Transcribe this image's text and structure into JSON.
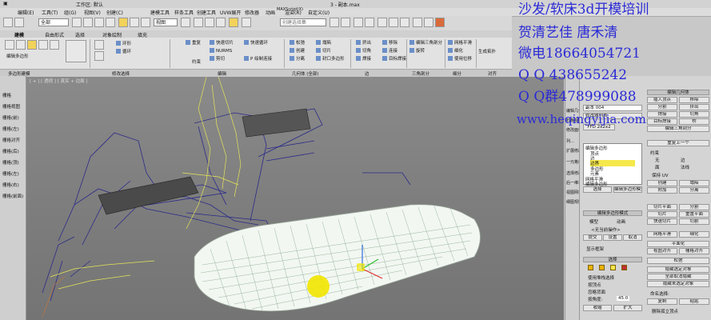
{
  "window": {
    "workspace_label": "工作区: 默认",
    "file_title": "3 - 副本.max",
    "colors": {
      "overlay_text": "#2b2bd6",
      "selection_highlight": "#f5e84a",
      "viewport_bg": "#808080",
      "mesh_wire": "#f2f7f2",
      "gizmo_yellow": "#f2e600"
    }
  },
  "menubar": {
    "items": [
      "编辑(E)",
      "工具(T)",
      "组(G)",
      "视图(V)",
      "创建(C)",
      "修改器",
      "动画",
      "图形编辑器",
      "渲染(R)",
      "Civil View",
      "自定义(U)",
      "脚本(S)",
      "MAXScript(X)",
      "帮助(H)"
    ],
    "contextual_tabs": [
      "建模工具",
      "样条工具",
      "创建工具",
      "UVW展开",
      "渲染(R)",
      "MAXScript(X)"
    ]
  },
  "toolbar": {
    "undo_combo": "全部",
    "view_combo": "视图",
    "selection_set_placeholder": "创建选择集"
  },
  "ribbon": {
    "tabs": [
      "建模",
      "自由形式",
      "选择",
      "对象绘制",
      "填充"
    ],
    "groups": {
      "polygon_modeling": "多边形建模",
      "modify_selection": "修改选择",
      "edit": "编辑",
      "geometry_all": "几何体 (全部)",
      "edges": "边",
      "loops": "循环",
      "tris": "三角剖分",
      "subdivision": "细分",
      "align": "对齐"
    },
    "edit_buttons": [
      "重复",
      "快速切片",
      "快速循环",
      "NURMS",
      "剪切",
      "约束",
      "P 绘制连接"
    ],
    "geometry_buttons": [
      "松弛",
      "创建",
      "分离",
      "塌陷",
      "切片",
      "封口多边形"
    ],
    "edge_buttons": [
      "挤出",
      "切角",
      "焊接",
      "移除",
      "连接",
      "目标焊接"
    ],
    "loop_buttons": [
      "编辑三角剖分",
      "旋转"
    ],
    "subdiv_buttons": [
      "网格平滑",
      "细化",
      "使用位移"
    ],
    "preview": "生成拓扑"
  },
  "viewport": {
    "label": "[ + ] [ 透视 ] [ 真实 + 边面 ]"
  },
  "left_panel": {
    "items": [
      "栅格",
      "栅格视图",
      "栅格(前)",
      "栅格(左)",
      "栅格对齐",
      "栅格(后)",
      "栅格(顶)",
      "栅格(左)",
      "栅格(右)",
      "栅格(前面)",
      "栅格(底部)",
      "栅格(底部)"
    ]
  },
  "mid_panel": {
    "items": [
      "编辑几何",
      "石板视图",
      "修改面板",
      "列…",
      "扩展修改",
      "一元格板",
      "选择修改",
      "后一维视",
      "视图网格",
      "细图规则"
    ]
  },
  "command_panel": {
    "object_name": "副本 004",
    "modifier_list": "修改器列表",
    "ffd_button": "FFD 2x2x2",
    "stack_items": [
      "编辑多边形",
      "顶点",
      "边",
      "边界",
      "多边形",
      "元素",
      "网格平滑",
      "编辑多边形"
    ],
    "stack_buttons": [
      "选择",
      "编辑多边形模式"
    ],
    "edit_poly_mode": {
      "header": "编辑多边形模式",
      "mode_model": "模型",
      "mode_anim": "动画",
      "no_op": "<无当前操作>",
      "commit": "提交",
      "settings": "设置",
      "cancel": "取消",
      "show_cage": "显示框架"
    },
    "selection": {
      "header": "选择",
      "use_stack": "使用堆栈选择",
      "by_vertex": "按顶点",
      "ignore_back": "忽略背面",
      "angle_label": "按角度:",
      "angle_value": "45.0",
      "shrink": "收缩",
      "grow": "扩大",
      "ring": "环形",
      "loop": "循环"
    },
    "edit_geometry": {
      "header": "编辑几何体",
      "repeat_last": "重复上一个",
      "constraints": "约束",
      "none": "无",
      "edge": "边",
      "face": "面",
      "normal": "法线",
      "preserve_uvs": "保持 UV",
      "create": "创建",
      "collapse": "塌陷",
      "attach": "附加",
      "detach": "分离",
      "slice_plane": "切片平面",
      "split": "分割",
      "slice": "切片",
      "reset_plane": "重置平面",
      "quick_slice": "快速切片",
      "cut": "切割",
      "msmooth": "网格平滑",
      "tessellate": "细化",
      "make_planar": "平面化",
      "view_align": "视图对齐",
      "grid_align": "栅格对齐",
      "relax": "松弛",
      "hide_sel": "隐藏选定对象",
      "unhide_all": "全部取消隐藏",
      "hide_unsel": "隐藏未选定对象",
      "named_sel": "命名选择:",
      "copy": "复制",
      "paste": "粘贴",
      "delete_iso": "删除孤立顶点",
      "insert_vertex": "插入顶点",
      "hinge": "翻转"
    },
    "sub_selection": {
      "header": "编辑边界",
      "insert_vertex": "插入顶点",
      "extrude": "挤出",
      "weld": "焊接",
      "chamfer": "切角",
      "target_weld": "目标焊接",
      "bridge": "桥",
      "connect": "连接"
    }
  },
  "overlay": {
    "line1": "沙发/软床3d开模培训",
    "line2": "贺清艺佳  唐禾清",
    "line3": "微电18664054721",
    "line4": "Q Q   438655242",
    "line5": "Q Q群478999088",
    "line6": "www.heqingyijia.com"
  }
}
